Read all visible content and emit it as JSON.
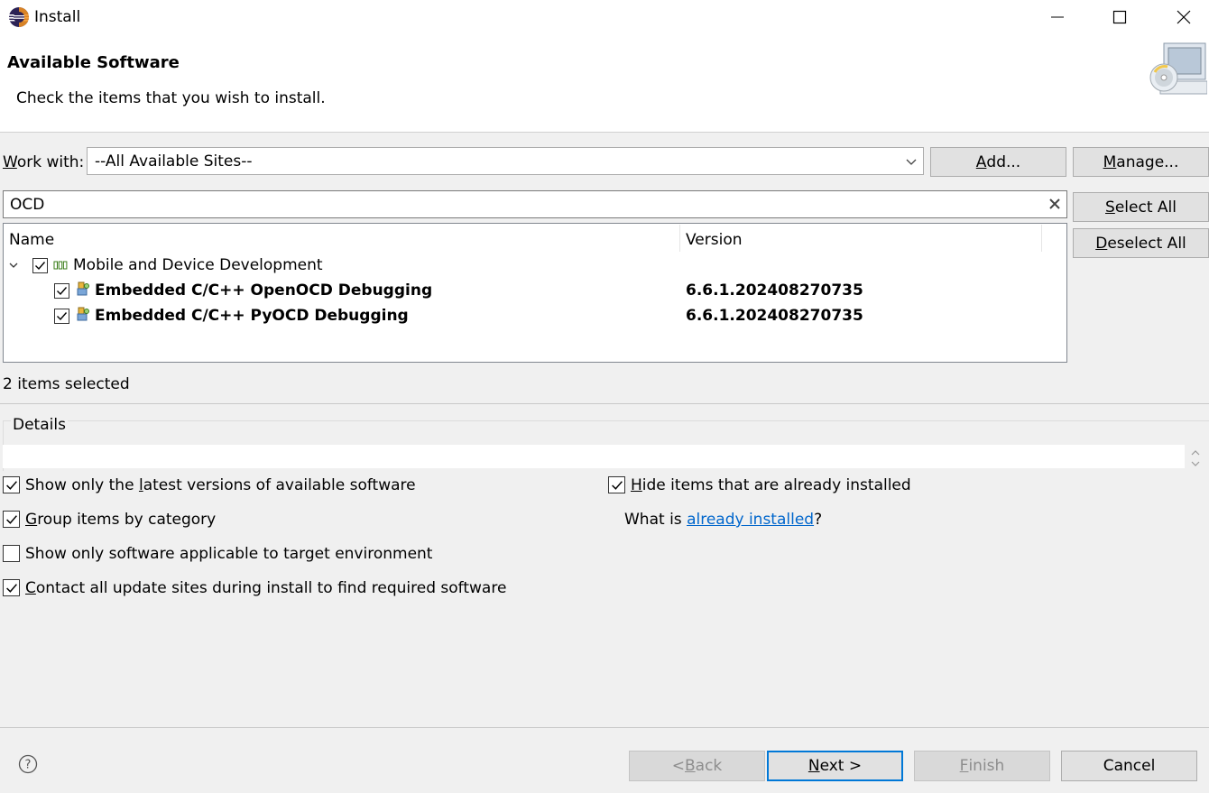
{
  "window": {
    "title": "Install",
    "minimize_icon": "minimize-icon",
    "maximize_icon": "maximize-icon",
    "close_icon": "close-icon"
  },
  "header": {
    "title": "Available Software",
    "subtitle": "Check the items that you wish to install."
  },
  "work_with": {
    "label_key": "W",
    "label_rest": "ork with:",
    "value": "--All Available Sites--",
    "add_key": "A",
    "add_rest": "dd...",
    "manage_key": "M",
    "manage_rest": "anage..."
  },
  "filter": {
    "value": "OCD",
    "clear_icon": "clear-icon"
  },
  "side_buttons": {
    "select_all_key": "S",
    "select_all_rest": "elect All",
    "deselect_all_key": "D",
    "deselect_all_rest": "eselect All"
  },
  "tree": {
    "columns": [
      "Name",
      "Version"
    ],
    "category": {
      "label": "Mobile and Device Development",
      "checked": true,
      "expanded": true
    },
    "items": [
      {
        "name": "Embedded C/C++ OpenOCD Debugging",
        "version": "6.6.1.202408270735",
        "checked": true
      },
      {
        "name": "Embedded C/C++ PyOCD Debugging",
        "version": "6.6.1.202408270735",
        "checked": true
      }
    ]
  },
  "status": "2 items selected",
  "details": {
    "label": "Details"
  },
  "options": {
    "latest_pre": "Show only the ",
    "latest_key": "l",
    "latest_post": "atest versions of available software",
    "latest_checked": true,
    "group_key": "G",
    "group_rest": "roup items by category",
    "group_checked": true,
    "applicable": "Show only software applicable to target environment",
    "applicable_checked": false,
    "contact_key": "C",
    "contact_rest": "ontact all update sites during install to find required software",
    "contact_checked": true,
    "hide_key": "H",
    "hide_rest": "ide items that are already installed",
    "hide_checked": true,
    "what_is": "What is ",
    "already_installed_link": "already installed",
    "what_is_end": "?"
  },
  "footer": {
    "help_icon": "help-icon",
    "back_pre": "< ",
    "back_key": "B",
    "back_rest": "ack",
    "next_key": "N",
    "next_rest": "ext >",
    "finish_key": "F",
    "finish_rest": "inish",
    "cancel": "Cancel"
  }
}
